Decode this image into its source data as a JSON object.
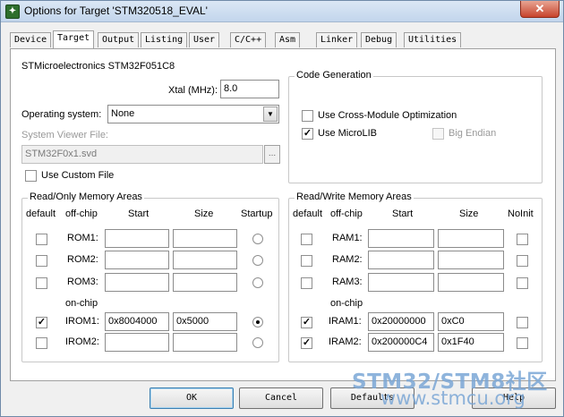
{
  "window": {
    "title": "Options for Target 'STM320518_EVAL'",
    "icon": "keil-app-icon",
    "close_glyph": "✕"
  },
  "tabs": [
    "Device",
    "Target",
    "Output",
    "Listing",
    "User",
    "C/C++",
    "Asm",
    "Linker",
    "Debug",
    "Utilities"
  ],
  "active_tab": "Target",
  "device": {
    "name": "STMicroelectronics STM32F051C8"
  },
  "xtal": {
    "label": "Xtal (MHz):",
    "value": "8.0"
  },
  "os": {
    "label": "Operating system:",
    "value": "None",
    "arrow": "▼"
  },
  "svd": {
    "label": "System Viewer File:",
    "value": "STM32F0x1.svd",
    "browse": "...",
    "custom_label": "Use Custom File",
    "custom_checked": false
  },
  "codegen": {
    "title": "Code Generation",
    "cross_module": {
      "label": "Use Cross-Module Optimization",
      "checked": false
    },
    "microlib": {
      "label": "Use MicroLIB",
      "checked": true
    },
    "big_endian": {
      "label": "Big Endian",
      "checked": false,
      "enabled": false
    }
  },
  "rom": {
    "title": "Read/Only Memory Areas",
    "headers": {
      "default": "default",
      "offchip": "off-chip",
      "start": "Start",
      "size": "Size",
      "startup": "Startup"
    },
    "onchip_label": "on-chip",
    "rows": [
      {
        "name": "ROM1:",
        "default": false,
        "start": "",
        "size": "",
        "startup": false
      },
      {
        "name": "ROM2:",
        "default": false,
        "start": "",
        "size": "",
        "startup": false
      },
      {
        "name": "ROM3:",
        "default": false,
        "start": "",
        "size": "",
        "startup": false
      },
      {
        "name": "IROM1:",
        "default": true,
        "start": "0x8004000",
        "size": "0x5000",
        "startup": true
      },
      {
        "name": "IROM2:",
        "default": false,
        "start": "",
        "size": "",
        "startup": false
      }
    ]
  },
  "ram": {
    "title": "Read/Write Memory Areas",
    "headers": {
      "default": "default",
      "offchip": "off-chip",
      "start": "Start",
      "size": "Size",
      "noinit": "NoInit"
    },
    "onchip_label": "on-chip",
    "rows": [
      {
        "name": "RAM1:",
        "default": false,
        "start": "",
        "size": "",
        "noinit": false
      },
      {
        "name": "RAM2:",
        "default": false,
        "start": "",
        "size": "",
        "noinit": false
      },
      {
        "name": "RAM3:",
        "default": false,
        "start": "",
        "size": "",
        "noinit": false
      },
      {
        "name": "IRAM1:",
        "default": true,
        "start": "0x20000000",
        "size": "0xC0",
        "noinit": false
      },
      {
        "name": "IRAM2:",
        "default": true,
        "start": "0x200000C4",
        "size": "0x1F40",
        "noinit": false
      }
    ]
  },
  "buttons": {
    "ok": "OK",
    "cancel": "Cancel",
    "defaults": "Defaults",
    "help": "Help"
  },
  "watermark": {
    "line1": "STM32/STM8社区",
    "line2": "www.stmcu.org"
  },
  "check_glyph": "✓"
}
